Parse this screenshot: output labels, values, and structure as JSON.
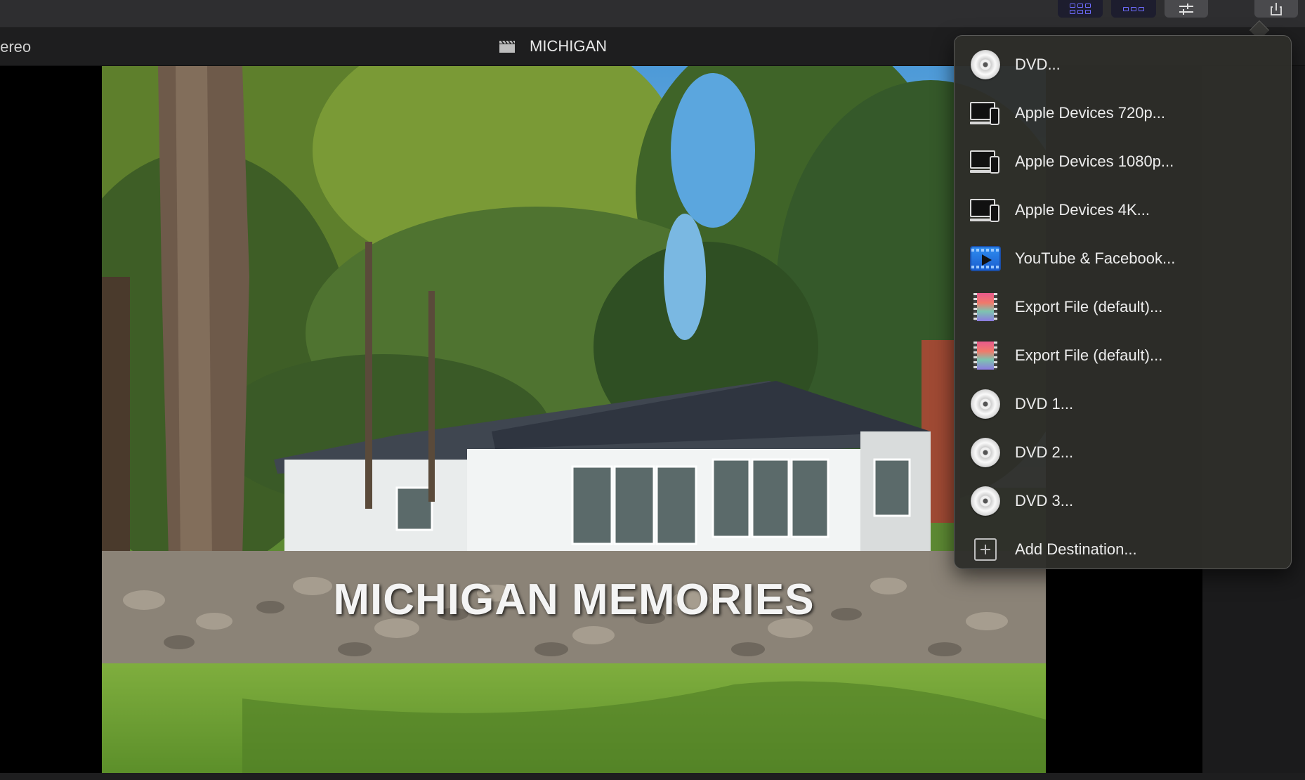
{
  "toolbar": {
    "buttons": [
      {
        "name": "grid-view-icon",
        "active": true
      },
      {
        "name": "filmstrip-view-icon",
        "active": true
      },
      {
        "name": "inspector-adjust-icon",
        "active": false
      },
      {
        "name": "share-icon",
        "active": false
      }
    ]
  },
  "viewer_header": {
    "audio_label": "tereo",
    "project_title": "MICHIGAN",
    "project_icon": "clapperboard-icon"
  },
  "viewer": {
    "frame_title": "MICHIGAN MEMORIES"
  },
  "share_menu": {
    "items": [
      {
        "label": "DVD...",
        "icon": "dvd-icon"
      },
      {
        "label": "Apple Devices 720p...",
        "icon": "apple-devices-icon"
      },
      {
        "label": "Apple Devices 1080p...",
        "icon": "apple-devices-icon"
      },
      {
        "label": "Apple Devices 4K...",
        "icon": "apple-devices-icon"
      },
      {
        "label": "YouTube & Facebook...",
        "icon": "youtube-facebook-icon"
      },
      {
        "label": "Export File (default)...",
        "icon": "export-file-icon"
      },
      {
        "label": "Export File (default)...",
        "icon": "export-file-icon"
      },
      {
        "label": "DVD 1...",
        "icon": "dvd-icon"
      },
      {
        "label": "DVD 2...",
        "icon": "dvd-icon"
      },
      {
        "label": "DVD 3...",
        "icon": "dvd-icon"
      },
      {
        "label": "Add Destination...",
        "icon": "add-icon"
      }
    ]
  },
  "colors": {
    "toolbar_bg": "#2e2e30",
    "menu_bg": "#2e2e2a",
    "accent_icon": "#6e6cff",
    "text": "#ececec"
  }
}
